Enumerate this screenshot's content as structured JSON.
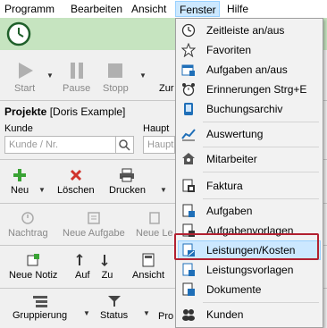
{
  "menubar": {
    "items": [
      "Programm",
      "Bearbeiten",
      "Ansicht",
      "Fenster",
      "Hilfe"
    ],
    "active": "Fenster"
  },
  "timer": {
    "buttons": [
      "Start",
      "Pause",
      "Stopp",
      "Zur"
    ]
  },
  "projects": {
    "title": "Projekte",
    "context": "[Doris Example]",
    "customer_label": "Kunde",
    "customer_placeholder": "Kunde / Nr.",
    "main_label": "Haupt",
    "main_placeholder": "Haupt"
  },
  "toolbar1": [
    "Neu",
    "Löschen",
    "Drucken"
  ],
  "toolbar2": [
    "Nachtrag",
    "Neue Aufgabe",
    "Neue Le"
  ],
  "toolbar3": [
    "Neue Notiz",
    "Auf",
    "Zu",
    "Ansicht"
  ],
  "toolbar4": [
    "Gruppierung",
    "Status",
    "Pro"
  ],
  "fenster_menu": {
    "items": [
      {
        "label": "Zeitleiste an/aus",
        "icon": "clock-icon"
      },
      {
        "label": "Favoriten",
        "icon": "star-icon"
      },
      {
        "label": "Aufgaben an/aus",
        "icon": "calendar-tasks-icon"
      },
      {
        "label": "Erinnerungen Strg+E",
        "icon": "alarm-clock-icon"
      },
      {
        "label": "Buchungsarchiv",
        "icon": "archive-device-icon"
      },
      {
        "label": "Auswertung",
        "icon": "chart-icon"
      },
      {
        "label": "Mitarbeiter",
        "icon": "employee-icon"
      },
      {
        "label": "Faktura",
        "icon": "invoice-icon"
      },
      {
        "label": "Aufgaben",
        "icon": "task-doc-icon"
      },
      {
        "label": "Aufgabenvorlagen",
        "icon": "task-template-icon"
      },
      {
        "label": "Leistungen/Kosten",
        "icon": "services-costs-icon"
      },
      {
        "label": "Leistungsvorlagen",
        "icon": "service-template-icon"
      },
      {
        "label": "Dokumente",
        "icon": "documents-icon"
      },
      {
        "label": "Kunden",
        "icon": "customers-icon"
      }
    ],
    "highlighted": "Leistungen/Kosten"
  },
  "colors": {
    "timer_bar": "#c6e4c0",
    "menu_highlight": "#cce8ff",
    "highlight_frame": "#b22030"
  }
}
